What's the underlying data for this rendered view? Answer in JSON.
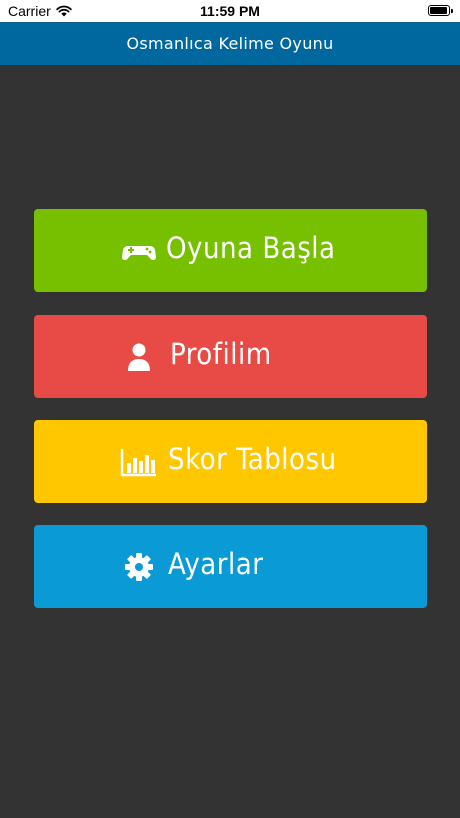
{
  "status_bar": {
    "carrier": "Carrier",
    "time": "11:59 PM"
  },
  "nav": {
    "title": "Osmanlıca Kelime Oyunu"
  },
  "menu": {
    "start": {
      "label": "Oyuna Başla",
      "icon": "gamepad-icon",
      "color": "#77c000"
    },
    "profile": {
      "label": "Profilim",
      "icon": "user-icon",
      "color": "#e84a45"
    },
    "scores": {
      "label": "Skor Tablosu",
      "icon": "bar-chart-icon",
      "color": "#ffc700"
    },
    "settings": {
      "label": "Ayarlar",
      "icon": "gear-icon",
      "color": "#0a9ad6"
    }
  },
  "colors": {
    "background": "#333333",
    "nav_bar": "#00689f"
  }
}
